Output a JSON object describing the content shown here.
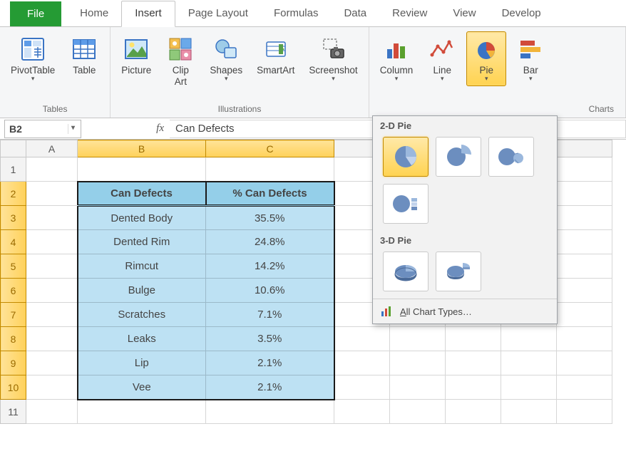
{
  "tabs": {
    "file": "File",
    "home": "Home",
    "insert": "Insert",
    "page_layout": "Page Layout",
    "formulas": "Formulas",
    "data": "Data",
    "review": "Review",
    "view": "View",
    "developer": "Develop"
  },
  "ribbon": {
    "groups": {
      "tables": "Tables",
      "illustrations": "Illustrations",
      "charts": "Charts"
    },
    "buttons": {
      "pivot_table": "PivotTable",
      "table": "Table",
      "picture": "Picture",
      "clip_art_1": "Clip",
      "clip_art_2": "Art",
      "shapes": "Shapes",
      "smartart": "SmartArt",
      "screenshot": "Screenshot",
      "column": "Column",
      "line": "Line",
      "pie": "Pie",
      "bar": "Bar"
    }
  },
  "formula_bar": {
    "name_box": "B2",
    "fx": "fx",
    "value": "Can Defects"
  },
  "columns": [
    "A",
    "B",
    "C"
  ],
  "row_numbers": [
    1,
    2,
    3,
    4,
    5,
    6,
    7,
    8,
    9,
    10,
    11
  ],
  "selected_rows": [
    2,
    3,
    4,
    5,
    6,
    7,
    8,
    9,
    10
  ],
  "data_table": {
    "headers": {
      "c1": "Can Defects",
      "c2": "% Can Defects"
    },
    "rows": [
      {
        "label": "Dented Body",
        "value": "35.5%"
      },
      {
        "label": "Dented Rim",
        "value": "24.8%"
      },
      {
        "label": "Rimcut",
        "value": "14.2%"
      },
      {
        "label": "Bulge",
        "value": "10.6%"
      },
      {
        "label": "Scratches",
        "value": "7.1%"
      },
      {
        "label": "Leaks",
        "value": "3.5%"
      },
      {
        "label": "Lip",
        "value": "2.1%"
      },
      {
        "label": "Vee",
        "value": "2.1%"
      }
    ]
  },
  "pie_panel": {
    "label_2d": "2-D Pie",
    "label_3d": "3-D Pie",
    "all_types": "All Chart Types…"
  },
  "chart_data": {
    "type": "pie",
    "title": "Can Defects",
    "categories": [
      "Dented Body",
      "Dented Rim",
      "Rimcut",
      "Bulge",
      "Scratches",
      "Leaks",
      "Lip",
      "Vee"
    ],
    "values": [
      35.5,
      24.8,
      14.2,
      10.6,
      7.1,
      3.5,
      2.1,
      2.1
    ],
    "value_suffix": "%"
  }
}
